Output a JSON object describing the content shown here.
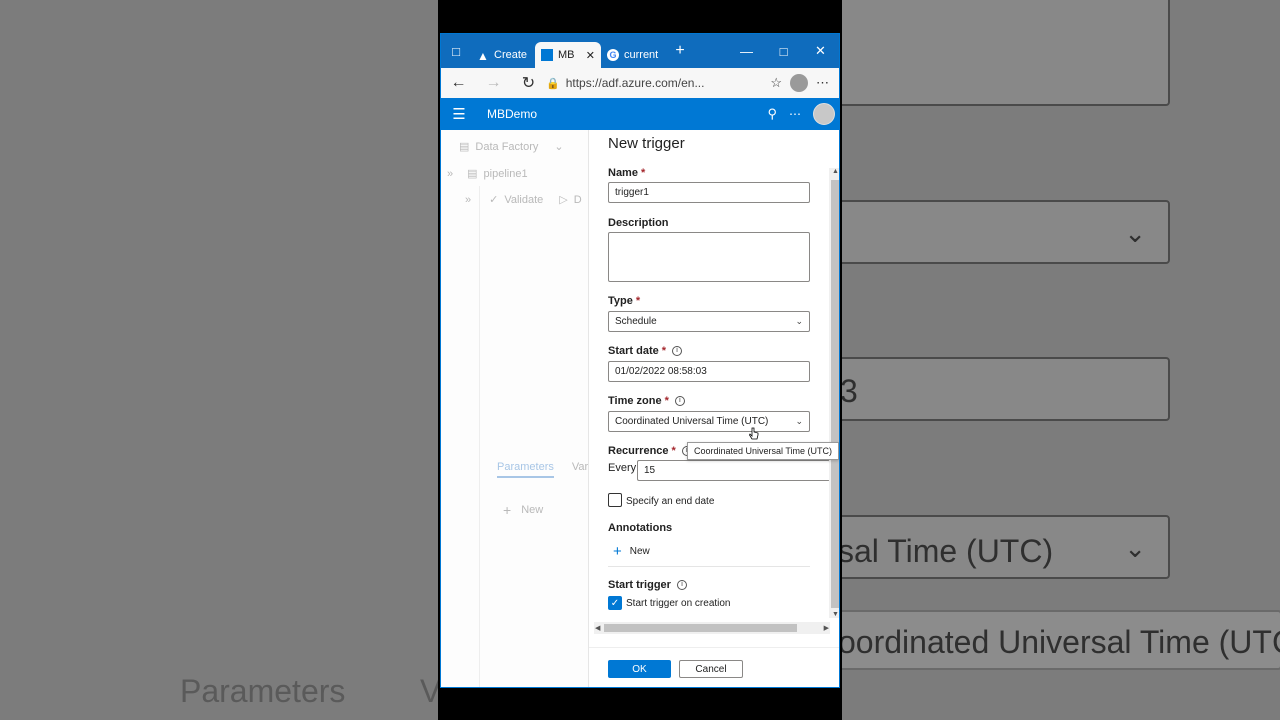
{
  "background": {
    "parameters_label": "Parameters",
    "v_fragment": "V",
    "zoom_field_value_fragment": "3",
    "zoom_timezone": "sal Time (UTC)",
    "zoom_tooltip": "oordinated Universal Time (UTC)"
  },
  "browser": {
    "tabs": [
      {
        "label": "Create"
      },
      {
        "label": "MB"
      },
      {
        "label": "current"
      }
    ],
    "url": "https://adf.azure.com/en..."
  },
  "adf": {
    "title": "MBDemo"
  },
  "left_pane": {
    "breadcrumb": "Data Factory",
    "pipeline": "pipeline1",
    "validate": "Validate",
    "d_fragment": "D",
    "tab_parameters": "Parameters",
    "tab_fragment": "Var",
    "new_label": "New"
  },
  "trigger_panel": {
    "title": "New trigger",
    "name_label": "Name",
    "name_value": "trigger1",
    "description_label": "Description",
    "description_value": "",
    "type_label": "Type",
    "type_value": "Schedule",
    "start_date_label": "Start date",
    "start_date_value": "01/02/2022 08:58:03",
    "timezone_label": "Time zone",
    "timezone_value": "Coordinated Universal Time (UTC)",
    "timezone_tooltip": "Coordinated Universal Time (UTC)",
    "recurrence_label": "Recurrence",
    "every_label": "Every",
    "every_value": "15",
    "end_date_label": "Specify an end date",
    "annotations_label": "Annotations",
    "annotations_new": "New",
    "start_trigger_label": "Start trigger",
    "start_on_creation_label": "Start trigger on creation",
    "ok_label": "OK",
    "cancel_label": "Cancel"
  },
  "colors": {
    "accent": "#0078d4",
    "tabbar": "#0f6cbd"
  }
}
